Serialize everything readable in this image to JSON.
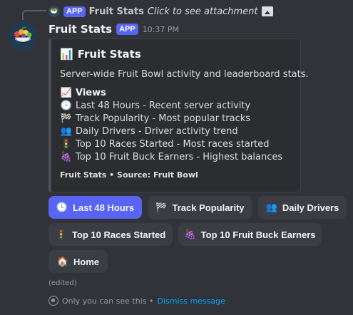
{
  "reply": {
    "author": "Fruit Stats",
    "badge": "APP",
    "text": "Click to see attachment",
    "icon": "image-icon"
  },
  "message": {
    "author": "Fruit Stats",
    "badge": "APP",
    "timestamp": "10:37 PM",
    "edited": "(edited)"
  },
  "embed": {
    "title_emoji": "📊",
    "title": "Fruit Stats",
    "description": "Server-wide Fruit Bowl activity and leaderboard stats.",
    "views_emoji": "📈",
    "views_heading": "Views",
    "views": [
      {
        "emoji": "🕒",
        "text": "Last 48 Hours - Recent server activity"
      },
      {
        "emoji": "🏁",
        "text": "Track Popularity - Most popular tracks"
      },
      {
        "emoji": "👥",
        "text": "Daily Drivers - Driver activity trend"
      },
      {
        "emoji": "🚦",
        "text": "Top 10 Races Started - Most races started"
      },
      {
        "emoji": "🍇",
        "text": "Top 10 Fruit Buck Earners - Highest balances"
      }
    ],
    "footer": "Fruit Stats • Source: Fruit Bowl",
    "accent_color": "#4e5058"
  },
  "buttons": [
    {
      "emoji": "🕒",
      "label": "Last 48 Hours",
      "active": true
    },
    {
      "emoji": "🏁",
      "label": "Track Popularity",
      "active": false
    },
    {
      "emoji": "👥",
      "label": "Daily Drivers",
      "active": false
    },
    {
      "emoji": "🚦",
      "label": "Top 10 Races Started",
      "active": false
    },
    {
      "emoji": "🍇",
      "label": "Top 10 Fruit Buck Earners",
      "active": false
    },
    {
      "emoji": "🏠",
      "label": "Home",
      "active": false
    }
  ],
  "ephemeral": {
    "text": "Only you can see this •",
    "dismiss": "Dismiss message"
  },
  "colors": {
    "background": "#323339",
    "brand": "#5865f2",
    "link": "#00a8fc"
  }
}
